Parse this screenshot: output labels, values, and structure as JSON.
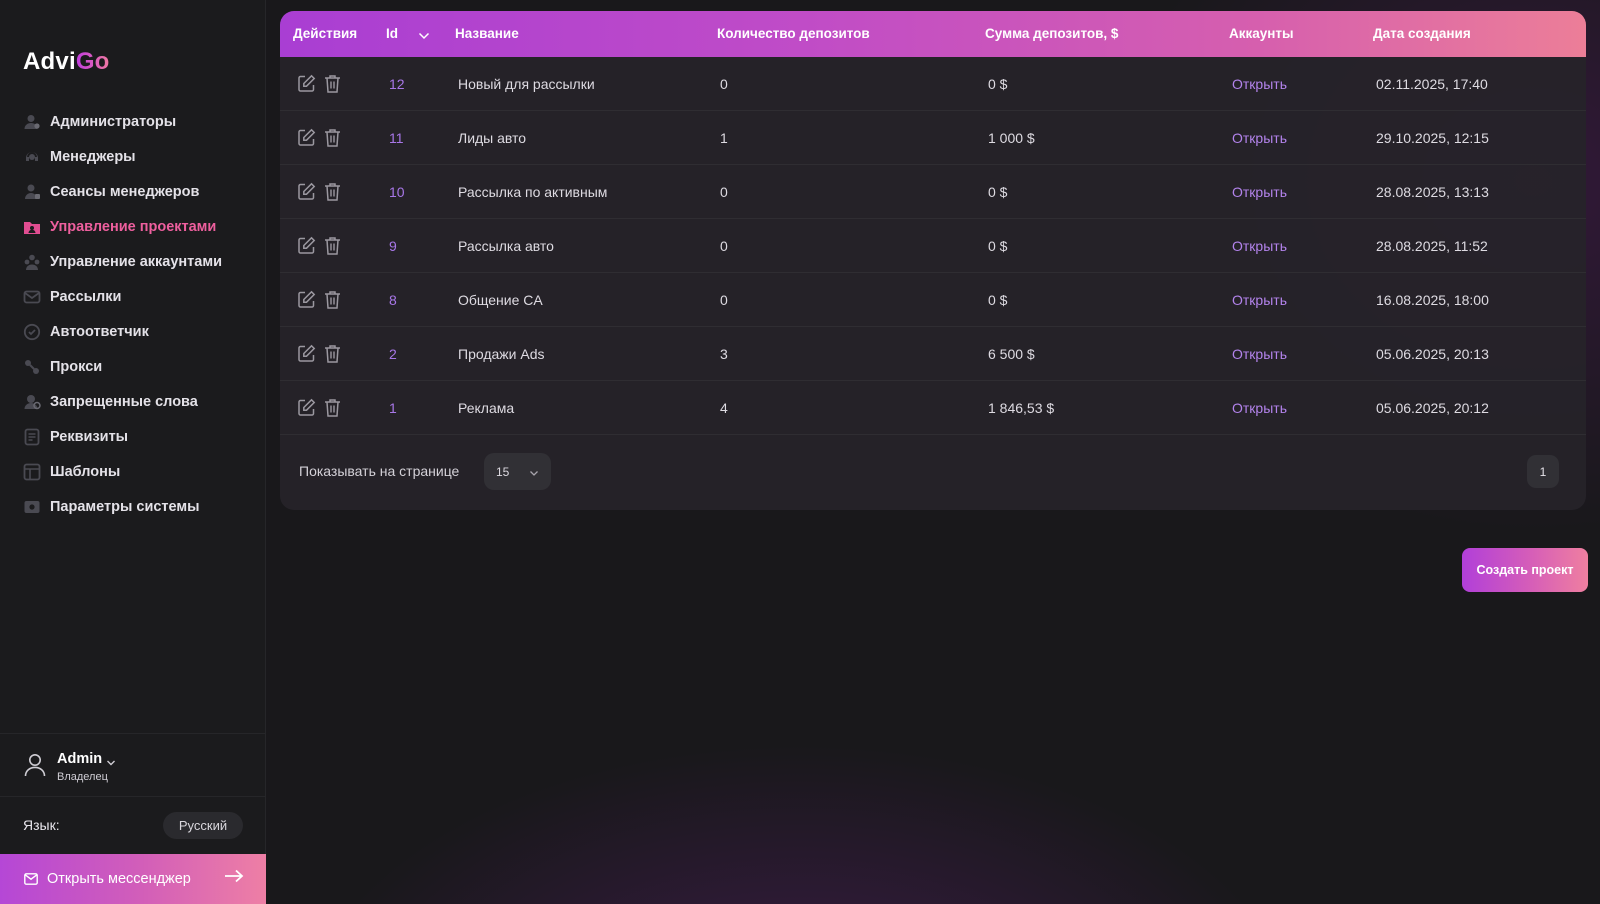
{
  "brand": {
    "logo_main": "Advi",
    "logo_accent": "Go"
  },
  "sidebar": {
    "items": [
      {
        "label": "Администраторы",
        "icon": "admin-icon"
      },
      {
        "label": "Менеджеры",
        "icon": "headset-icon"
      },
      {
        "label": "Сеансы менеджеров",
        "icon": "user-session-icon"
      },
      {
        "label": "Управление проектами",
        "icon": "projects-icon",
        "active": true
      },
      {
        "label": "Управление аккаунтами",
        "icon": "accounts-icon"
      },
      {
        "label": "Рассылки",
        "icon": "mailing-icon"
      },
      {
        "label": "Автоответчик",
        "icon": "autoreply-icon"
      },
      {
        "label": "Прокси",
        "icon": "proxy-icon"
      },
      {
        "label": "Запрещенные слова",
        "icon": "banned-words-icon"
      },
      {
        "label": "Реквизиты",
        "icon": "requisites-icon"
      },
      {
        "label": "Шаблоны",
        "icon": "templates-icon"
      },
      {
        "label": "Параметры системы",
        "icon": "settings-icon"
      }
    ]
  },
  "user": {
    "name": "Admin",
    "role": "Владелец"
  },
  "language": {
    "label": "Язык:",
    "value": "Русский"
  },
  "messenger": {
    "label": "Открыть мессенджер"
  },
  "table": {
    "headers": {
      "actions": "Действия",
      "id": "Id",
      "name": "Название",
      "deposit_count": "Количество депозитов",
      "deposit_sum": "Сумма депозитов, $",
      "accounts": "Аккаунты",
      "created": "Дата создания"
    },
    "rows": [
      {
        "id": "12",
        "name": "Новый для рассылки",
        "deposit_count": "0",
        "deposit_sum": "0 $",
        "accounts": "Открыть",
        "created": "02.11.2025, 17:40"
      },
      {
        "id": "11",
        "name": "Лиды авто",
        "deposit_count": "1",
        "deposit_sum": "1 000 $",
        "accounts": "Открыть",
        "created": "29.10.2025, 12:15"
      },
      {
        "id": "10",
        "name": "Рассылка по активным",
        "deposit_count": "0",
        "deposit_sum": "0 $",
        "accounts": "Открыть",
        "created": "28.08.2025, 13:13"
      },
      {
        "id": "9",
        "name": "Рассылка авто",
        "deposit_count": "0",
        "deposit_sum": "0 $",
        "accounts": "Открыть",
        "created": "28.08.2025, 11:52"
      },
      {
        "id": "8",
        "name": "Общение CA",
        "deposit_count": "0",
        "deposit_sum": "0 $",
        "accounts": "Открыть",
        "created": "16.08.2025, 18:00"
      },
      {
        "id": "2",
        "name": "Продажи Ads",
        "deposit_count": "3",
        "deposit_sum": "6 500 $",
        "accounts": "Открыть",
        "created": "05.06.2025, 20:13"
      },
      {
        "id": "1",
        "name": "Реклама",
        "deposit_count": "4",
        "deposit_sum": "1 846,53 $",
        "accounts": "Открыть",
        "created": "05.06.2025, 20:12"
      }
    ]
  },
  "pagination": {
    "per_page_label": "Показывать на странице",
    "per_page_value": "15",
    "current_page": "1"
  },
  "create_button": {
    "label": "Создать проект"
  },
  "colors": {
    "accent_start": "#b13fd9",
    "accent_end": "#ef7fa0",
    "link": "#b383ec",
    "active_nav": "#ee5f9e"
  }
}
